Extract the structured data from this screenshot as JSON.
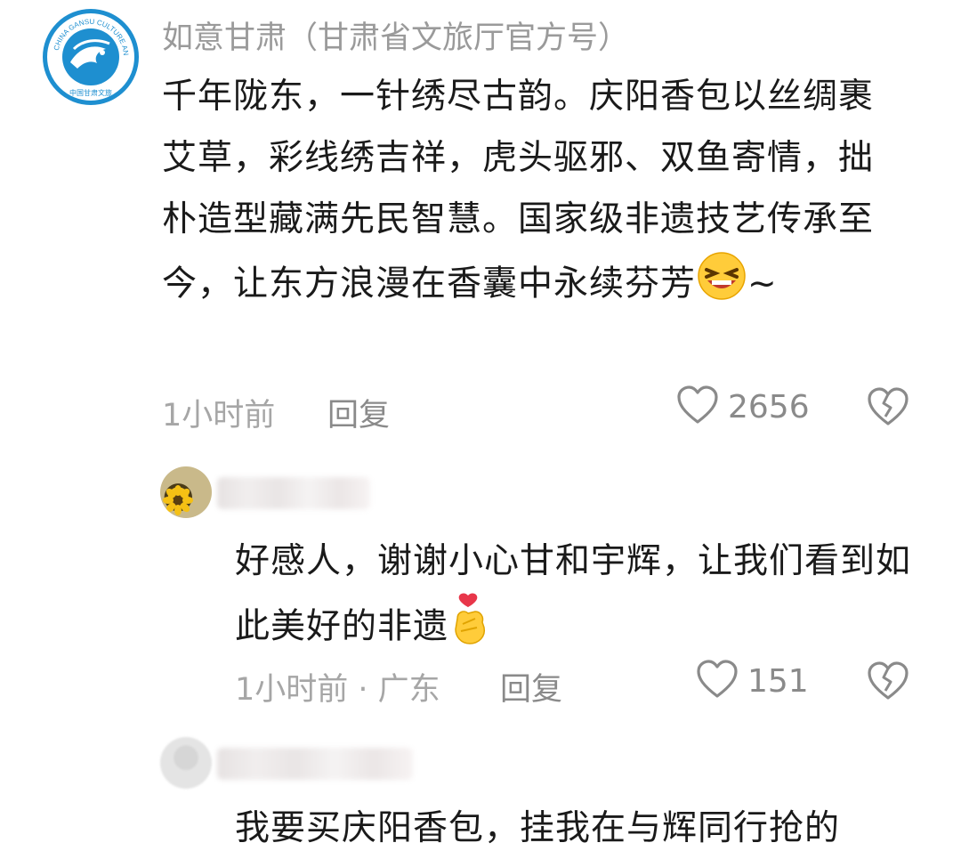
{
  "comments": [
    {
      "author": "如意甘肃（甘肃省文旅厅官方号）",
      "text": "千年陇东，一针绣尽古韵。庆阳香包以丝绸裹艾草，彩线绣吉祥，虎头驱邪、双鱼寄情，拙朴造型藏满先民智慧。国家级非遗技艺传承至今，让东方浪漫在香囊中永续芬芳",
      "emoji": "laughing-emoji",
      "trailing": "~",
      "time": "1小时前",
      "reply_label": "回复",
      "likes": "2656",
      "avatar_logo_text": "CHINA GANSU CULTURE AND TOURISM",
      "avatar_logo_cn": "中国甘肃文旅"
    },
    {
      "author": "",
      "text": "好感人，谢谢小心甘和宇辉，让我们看到如此美好的非遗",
      "emoji": "finger-heart-emoji",
      "time": "1小时前 · 广东",
      "reply_label": "回复",
      "likes": "151"
    },
    {
      "author": "",
      "text": "我要买庆阳香包，挂我在与辉同行抢的"
    }
  ],
  "colors": {
    "logo_blue": "#1e8fd0",
    "meta_gray": "#a6a6a6",
    "text": "#1a1a1a"
  }
}
